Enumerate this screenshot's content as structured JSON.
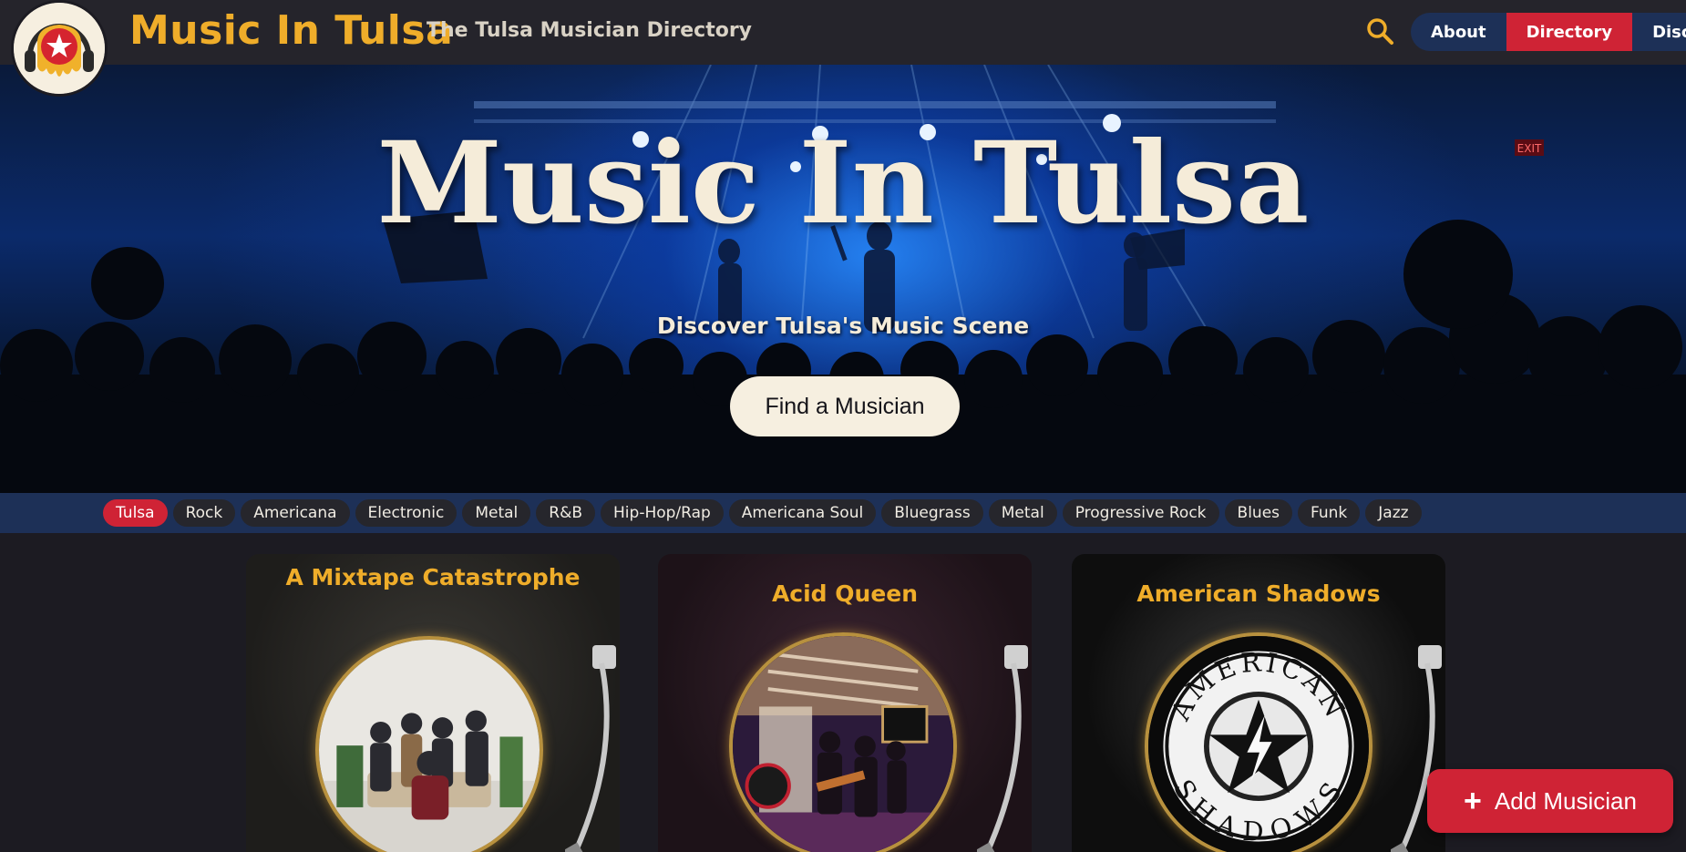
{
  "header": {
    "site_title": "Music In Tulsa",
    "tagline": "The Tulsa Musician Directory",
    "nav": [
      {
        "label": "About",
        "active": false
      },
      {
        "label": "Directory",
        "active": true
      },
      {
        "label": "Discover",
        "active": false
      }
    ],
    "search_icon": "search-icon",
    "accent_color": "#efad2a",
    "nav_active_color": "#cf2335"
  },
  "hero": {
    "title": "Music In Tulsa",
    "subtitle": "Discover Tulsa's Music Scene",
    "button_label": "Find a Musician",
    "exit_sign": "EXIT"
  },
  "genres": [
    {
      "label": "Tulsa",
      "active": true
    },
    {
      "label": "Rock"
    },
    {
      "label": "Americana"
    },
    {
      "label": "Electronic"
    },
    {
      "label": "Metal"
    },
    {
      "label": "R&B"
    },
    {
      "label": "Hip-Hop/Rap"
    },
    {
      "label": "Americana Soul"
    },
    {
      "label": "Bluegrass"
    },
    {
      "label": "Metal"
    },
    {
      "label": "Progressive Rock"
    },
    {
      "label": "Blues"
    },
    {
      "label": "Funk"
    },
    {
      "label": "Jazz"
    }
  ],
  "musicians": [
    {
      "name": "A Mixtape Catastrophe"
    },
    {
      "name": "Acid Queen"
    },
    {
      "name": "American Shadows",
      "logo_text_top": "AMERICAN",
      "logo_text_bottom": "SHADOWS"
    }
  ],
  "add_button": {
    "label": "Add Musician",
    "icon": "plus-icon"
  }
}
